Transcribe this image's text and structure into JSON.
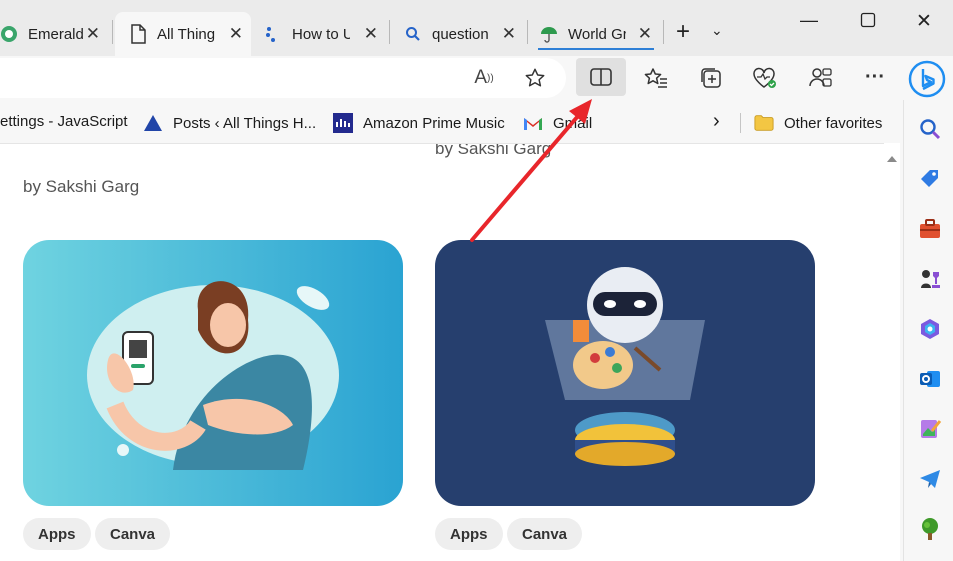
{
  "tabs": [
    {
      "title": "Emerald",
      "icon": "emerald-favicon-icon",
      "active": false
    },
    {
      "title": "All Things",
      "icon": "page-icon",
      "active": true
    },
    {
      "title": "How to U",
      "icon": "how-to-favicon-icon",
      "active": false
    },
    {
      "title": "question",
      "icon": "search-favicon-icon",
      "active": false
    },
    {
      "title": "World Gr",
      "icon": "umbrella-favicon-icon",
      "active": false
    }
  ],
  "toolbar": {
    "read_aloud": "A",
    "split_screen": "split-screen-icon",
    "favorites": "favorites-icon",
    "collections": "collections-icon",
    "health": "browser-essentials-icon",
    "profile": "profile-icon",
    "more": "···"
  },
  "bookmarks": [
    {
      "label": "ettings - JavaScript",
      "icon": ""
    },
    {
      "label": "Posts ‹ All Things H...",
      "icon": "triangle-icon"
    },
    {
      "label": "Amazon Prime Music",
      "icon": "music-icon"
    },
    {
      "label": "Gmail",
      "icon": "gmail-icon"
    },
    {
      "label": "Other favorites",
      "icon": "folder-icon"
    }
  ],
  "content": {
    "author_left": "by Sakshi Garg",
    "author_right": "by Sakshi Garg",
    "cards": [
      {
        "tags": [
          "Apps",
          "Canva"
        ],
        "bg": "#52c6dc"
      },
      {
        "tags": [
          "Apps",
          "Canva"
        ],
        "bg": "#263f6e"
      }
    ]
  },
  "colors": {
    "arrow": "#e8262b",
    "bing": "#1f8ef1"
  }
}
